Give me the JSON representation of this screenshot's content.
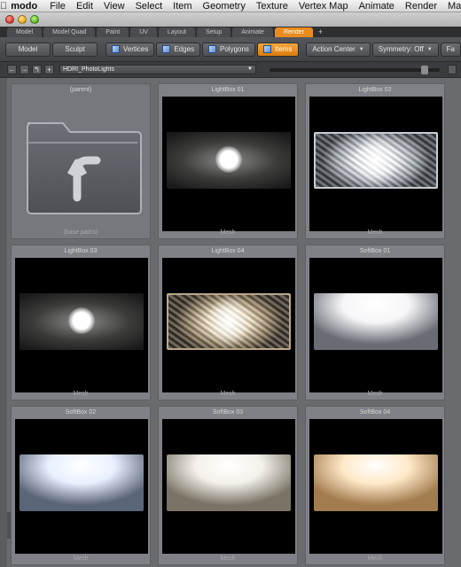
{
  "menubar": {
    "app": "modo",
    "items": [
      "File",
      "Edit",
      "View",
      "Select",
      "Item",
      "Geometry",
      "Texture",
      "Vertex Map",
      "Animate",
      "Render",
      "Ma"
    ]
  },
  "tabs": [
    "Model",
    "Model Quad",
    "Paint",
    "UV",
    "Layout",
    "Setup",
    "Animate",
    "Render",
    "+"
  ],
  "active_tab": "Render",
  "toolbar": {
    "model": "Model",
    "sculpt": "Sculpt",
    "vertices": "Vertices",
    "edges": "Edges",
    "polygons": "Polygons",
    "items": "Items",
    "action_center": "Action Center",
    "symmetry": "Symmetry: Off",
    "falloff": "Fa"
  },
  "browser": {
    "path": "HDRI_PhotoLights",
    "zoom_fraction": 0.93
  },
  "grid": {
    "parent": {
      "name": "(parent)",
      "footer": "(base paths)"
    },
    "items": [
      {
        "name": "LightBox 01",
        "type": "Mesh",
        "style": "dim-soft"
      },
      {
        "name": "LightBox 02",
        "type": "Mesh",
        "style": "crinkle-bright"
      },
      {
        "name": "LightBox 03",
        "type": "Mesh",
        "style": "dim-soft"
      },
      {
        "name": "LightBox 04",
        "type": "Mesh",
        "style": "crinkle-warm"
      },
      {
        "name": "SoftBox 01",
        "type": "Mesh",
        "style": "soft-white"
      },
      {
        "name": "SoftBox 02",
        "type": "Mesh",
        "style": "soft-cool"
      },
      {
        "name": "SoftBox 03",
        "type": "Mesh",
        "style": "soft-neutral"
      },
      {
        "name": "SoftBox 04",
        "type": "Mesh",
        "style": "soft-warm"
      }
    ]
  },
  "colors": {
    "accent": "#e98c1c",
    "grid_bg": "#696b6f",
    "cell_bg": "#7f8186"
  }
}
